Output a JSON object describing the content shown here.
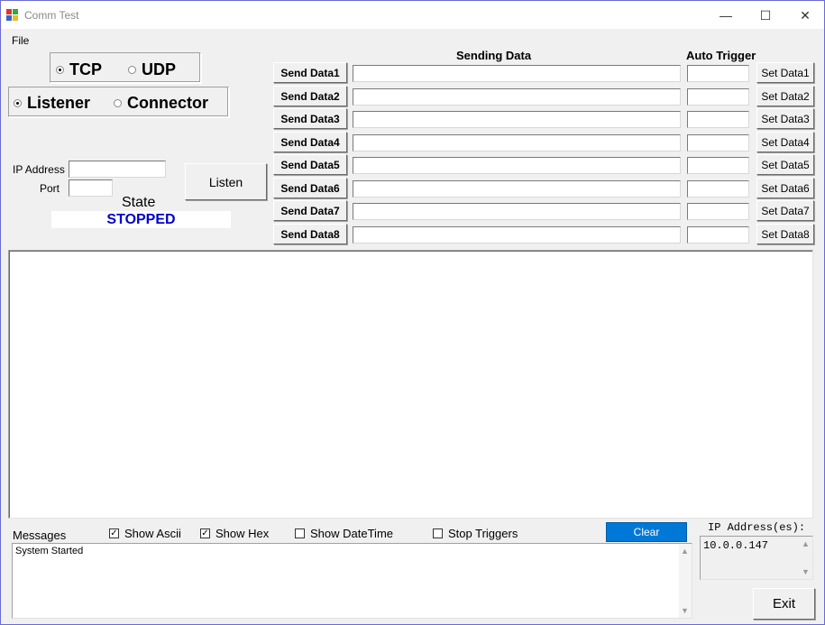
{
  "window": {
    "title": "Comm Test",
    "minimize_glyph": "—",
    "maximize_glyph": "☐",
    "close_glyph": "✕"
  },
  "menu": {
    "file": "File"
  },
  "protocol": {
    "tcp_label": "TCP",
    "udp_label": "UDP",
    "selected": "TCP"
  },
  "mode": {
    "listener_label": "Listener",
    "connector_label": "Connector",
    "selected": "Listener"
  },
  "connection": {
    "ip_label": "IP Address",
    "ip_value": "",
    "port_label": "Port",
    "port_value": "",
    "listen_button": "Listen",
    "state_label": "State",
    "state_value": "STOPPED"
  },
  "headers": {
    "sending_data": "Sending Data",
    "auto_trigger": "Auto Trigger"
  },
  "rows": [
    {
      "send": "Send Data1",
      "set": "Set Data1",
      "data": "",
      "trigger": ""
    },
    {
      "send": "Send Data2",
      "set": "Set Data2",
      "data": "",
      "trigger": ""
    },
    {
      "send": "Send Data3",
      "set": "Set Data3",
      "data": "",
      "trigger": ""
    },
    {
      "send": "Send Data4",
      "set": "Set Data4",
      "data": "",
      "trigger": ""
    },
    {
      "send": "Send Data5",
      "set": "Set Data5",
      "data": "",
      "trigger": ""
    },
    {
      "send": "Send Data6",
      "set": "Set Data6",
      "data": "",
      "trigger": ""
    },
    {
      "send": "Send Data7",
      "set": "Set Data7",
      "data": "",
      "trigger": ""
    },
    {
      "send": "Send Data8",
      "set": "Set Data8",
      "data": "",
      "trigger": ""
    }
  ],
  "options": {
    "messages_label": "Messages",
    "show_ascii": {
      "label": "Show Ascii",
      "checked": true
    },
    "show_hex": {
      "label": "Show Hex",
      "checked": true
    },
    "show_datetime": {
      "label": "Show DateTime",
      "checked": false
    },
    "stop_triggers": {
      "label": "Stop Triggers",
      "checked": false
    },
    "clear_button": "Clear"
  },
  "messages": {
    "text": "System Started"
  },
  "ip_addresses": {
    "label": "IP Address(es):",
    "value": "10.0.0.147"
  },
  "exit_button": "Exit",
  "colors": {
    "accent": "#0078d7",
    "state_text": "#0000cc",
    "border": "#6b6bd6"
  }
}
